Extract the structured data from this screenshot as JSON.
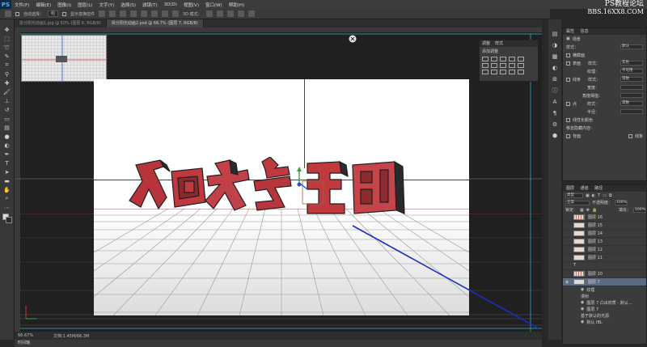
{
  "app": {
    "logo": "PS"
  },
  "menu": [
    "文件(F)",
    "编辑(E)",
    "图像(I)",
    "图层(L)",
    "文字(Y)",
    "选择(S)",
    "滤镜(T)",
    "3D(D)",
    "视图(V)",
    "窗口(W)",
    "帮助(H)"
  ],
  "watermark": {
    "line1": "PS教程论坛",
    "line2": "BBS.16XX8.COM"
  },
  "options": {
    "auto_select": "自动选择：",
    "layer_value": "组",
    "transform": "显示变换控件",
    "mode_3d": "3D 模式："
  },
  "doc_tabs": [
    {
      "label": "拆分阳光动画1.jpg @ 50% (图层 6, RGB/8)",
      "active": false
    },
    {
      "label": "拆分阳光动画2.psd @ 66.7% (图层 7, RGB/8)",
      "active": true
    }
  ],
  "status": {
    "zoom": "66.67%",
    "doc": "文档:1.45M/66.3M"
  },
  "bottom_tab": "时间轴",
  "adjustments": {
    "tabs": [
      "调整",
      "样式"
    ],
    "title": "添加调整"
  },
  "properties": {
    "tabs": [
      "属性",
      "信息"
    ],
    "header": "场景",
    "style_label": "样式：",
    "style_value": "默认",
    "cross_section": "横截面",
    "rows": [
      {
        "label": "表面",
        "k": "样式：",
        "v": "实色"
      },
      {
        "label": "",
        "k": "纹理：",
        "v": "不可用"
      },
      {
        "label": "线条",
        "k": "样式：",
        "v": "常数"
      },
      {
        "label": "",
        "k": "宽度：",
        "v": ""
      },
      {
        "label": "",
        "k": "角度阈值：",
        "v": ""
      },
      {
        "label": "点",
        "k": "样式：",
        "v": "常数"
      },
      {
        "label": "",
        "k": "半径：",
        "v": ""
      }
    ],
    "linearize": "线性化颜色",
    "remove_hidden": "移去隐藏内容：",
    "back": "背面",
    "lines": "线条"
  },
  "layers": {
    "tabs": [
      "图层",
      "通道",
      "路径"
    ],
    "kind": "类型",
    "mode": "正常",
    "opacity_label": "不透明度：",
    "opacity": "100%",
    "lock_label": "锁定：",
    "fill_label": "填充：",
    "fill": "100%",
    "items": [
      {
        "name": "图层 16",
        "selected": false,
        "striped": false
      },
      {
        "name": "图层 15",
        "selected": false,
        "striped": true
      },
      {
        "name": "图层 14",
        "selected": false,
        "striped": true
      },
      {
        "name": "图层 13",
        "selected": false,
        "striped": true
      },
      {
        "name": "图层 12",
        "selected": false,
        "striped": true
      },
      {
        "name": "图层 11",
        "selected": false,
        "striped": true
      },
      {
        "name": "T",
        "selected": false,
        "striped": false
      },
      {
        "name": "图层 10",
        "selected": false,
        "striped": false
      },
      {
        "name": "图层 7",
        "selected": true,
        "striped": false
      }
    ],
    "effects": [
      "纹理",
      "漫射",
      "图层 7 凸出材质 - 默认...",
      "图层 7",
      "基于默认的光源",
      "默认 IBL"
    ]
  },
  "colors": {
    "accent": "#5d6b82",
    "letter_red": "#c0393f",
    "guide_blue": "#1c2dbf",
    "canvas_bg": "#202020"
  }
}
